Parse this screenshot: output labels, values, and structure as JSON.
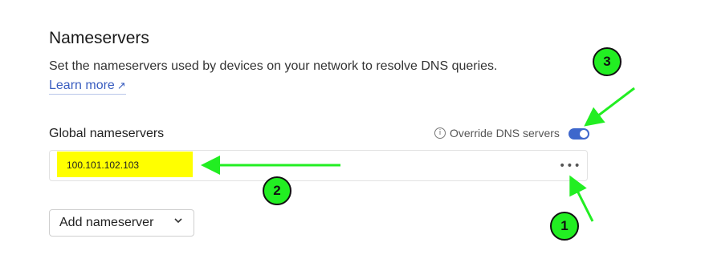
{
  "section": {
    "title": "Nameservers",
    "description": "Set the nameservers used by devices on your network to resolve DNS queries.",
    "learn_more": "Learn more",
    "learn_more_arrow": "↗"
  },
  "global": {
    "title": "Global nameservers",
    "override_label": "Override DNS servers",
    "override_enabled": true,
    "info_icon": "info-icon"
  },
  "nameservers": [
    {
      "address": "100.101.102.103",
      "menu": "•••"
    }
  ],
  "add_button": {
    "label": "Add nameserver"
  },
  "annotations": {
    "badge_1": "1",
    "badge_2": "2",
    "badge_3": "3",
    "badge_color": "#22ee22",
    "arrow_color": "#22ee22",
    "highlight_color": "#ffff00"
  },
  "colors": {
    "accent": "#3e67cc",
    "link": "#3a5ec0"
  }
}
